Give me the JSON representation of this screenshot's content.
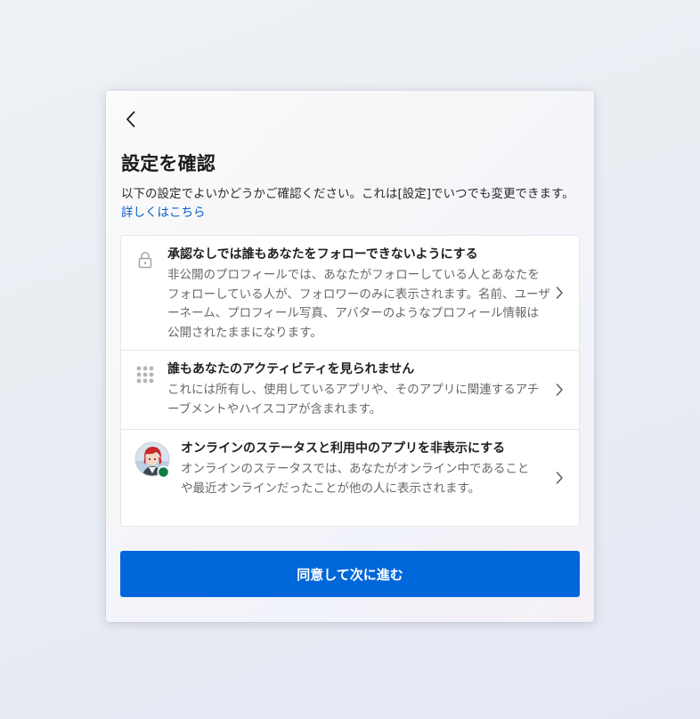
{
  "dialog": {
    "title": "設定を確認",
    "intro": "以下の設定でよいかどうかご確認ください。これは[設定]でいつでも変更できます。",
    "learn_more": "詳しくはこちら",
    "items": [
      {
        "icon": "lock-icon",
        "title": "承認なしでは誰もあなたをフォローできないようにする",
        "description": "非公開のプロフィールでは、あなたがフォローしている人とあなたをフォローしている人が、フォロワーのみに表示されます。名前、ユーザーネーム、プロフィール写真、アバターのようなプロフィール情報は公開されたままになります。"
      },
      {
        "icon": "grid-icon",
        "title": "誰もあなたのアクティビティを見られません",
        "description": "これには所有し、使用しているアプリや、そのアプリに関連するアチーブメントやハイスコアが含まれます。"
      },
      {
        "icon": "avatar-online",
        "title": "オンラインのステータスと利用中のアプリを非表示にする",
        "description": "オンラインのステータスでは、あなたがオンライン中であることや最近オンラインだったことが他の人に表示されます。"
      }
    ],
    "confirm_label": "同意して次に進む"
  },
  "colors": {
    "accent": "#0067da",
    "link": "#0a5ec6",
    "online": "#107c41"
  }
}
